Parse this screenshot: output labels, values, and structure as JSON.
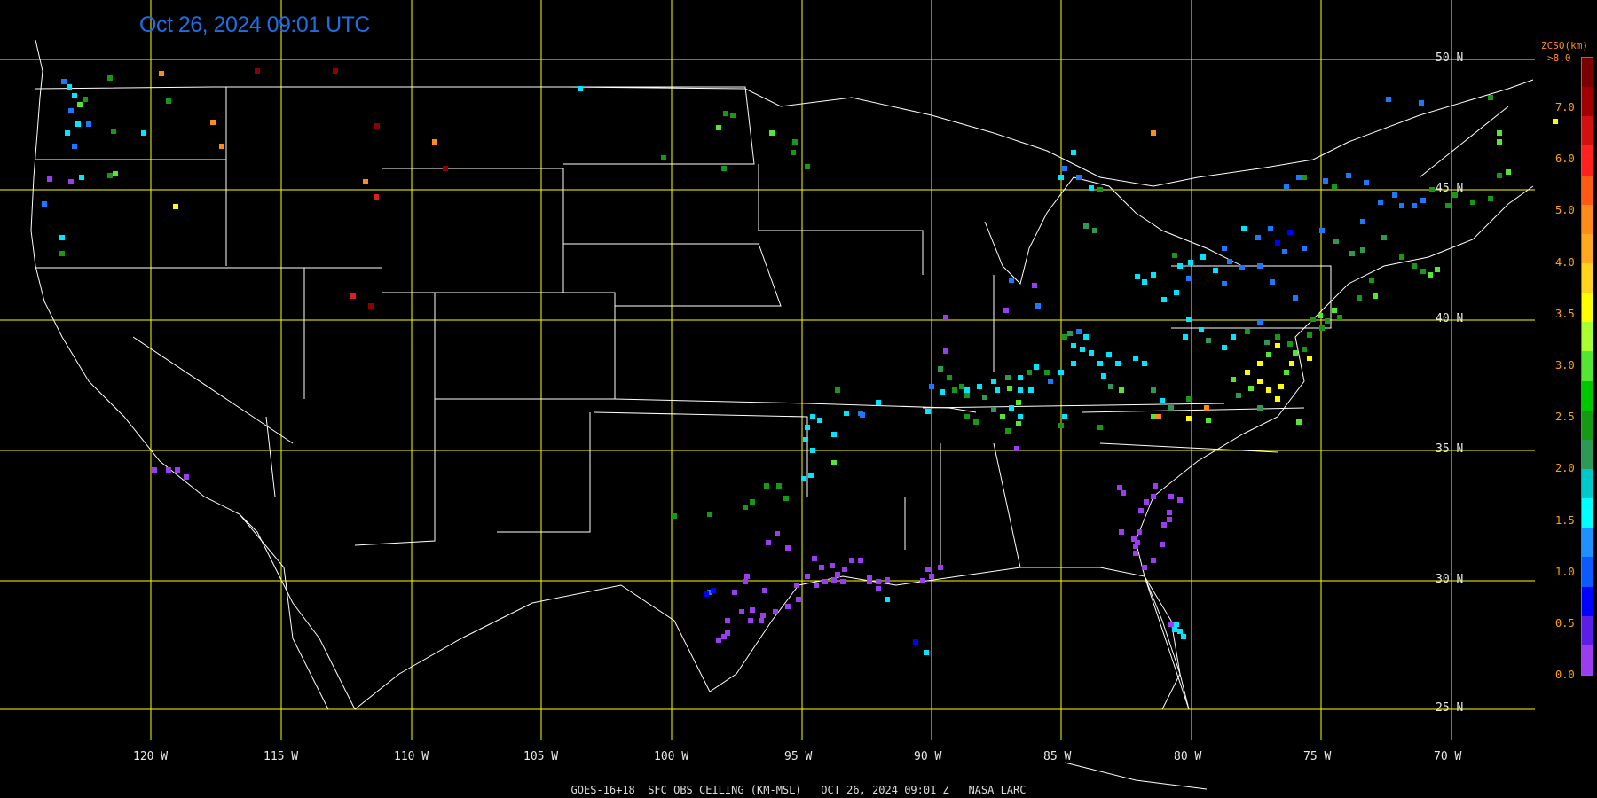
{
  "header": {
    "timestamp": "Oct 26, 2024 09:01 UTC"
  },
  "footer": {
    "text": "GOES-16+18  SFC OBS CEILING (KM-MSL)   OCT 26, 2024 09:01 Z   NASA LARC"
  },
  "grid": {
    "latitudes": [
      "50 N",
      "45 N",
      "40 N",
      "35 N",
      "30 N",
      "25 N"
    ],
    "longitudes": [
      "120 W",
      "115 W",
      "110 W",
      "105 W",
      "100 W",
      "95 W",
      "90 W",
      "85 W",
      "80 W",
      "75 W",
      "70 W"
    ],
    "color": "#ffff00"
  },
  "colorbar": {
    "title": "ZCSO(km)",
    "top_label": ">8.0",
    "ticks": [
      "7.0",
      "6.0",
      "5.0",
      "4.0",
      "3.5",
      "3.0",
      "2.5",
      "2.0",
      "1.5",
      "1.0",
      "0.5",
      "0.0"
    ],
    "colors": [
      "#7a0000",
      "#a00000",
      "#d21010",
      "#ff2020",
      "#ff5a14",
      "#ff8c1a",
      "#ffaa1e",
      "#ffd21e",
      "#ffff00",
      "#aaff33",
      "#55e633",
      "#00c800",
      "#169a16",
      "#2e9955",
      "#00c8c8",
      "#00ffff",
      "#1e90ff",
      "#0a5aff",
      "#0000ff",
      "#5a1ee6",
      "#9a3cf0"
    ]
  },
  "map": {
    "background": "#000000",
    "boundary_color": "#ffffff",
    "observation_colors": {
      "violet": "#9a3cf0",
      "blue": "#0000ff",
      "mid_blue": "#1e78ff",
      "cyan": "#00e6ff",
      "teal": "#2e9955",
      "green": "#169a16",
      "lime": "#55e633",
      "yellow": "#ffff00",
      "orange": "#ff8c1a",
      "red": "#dc2020",
      "dark_red": "#8b0000"
    }
  }
}
